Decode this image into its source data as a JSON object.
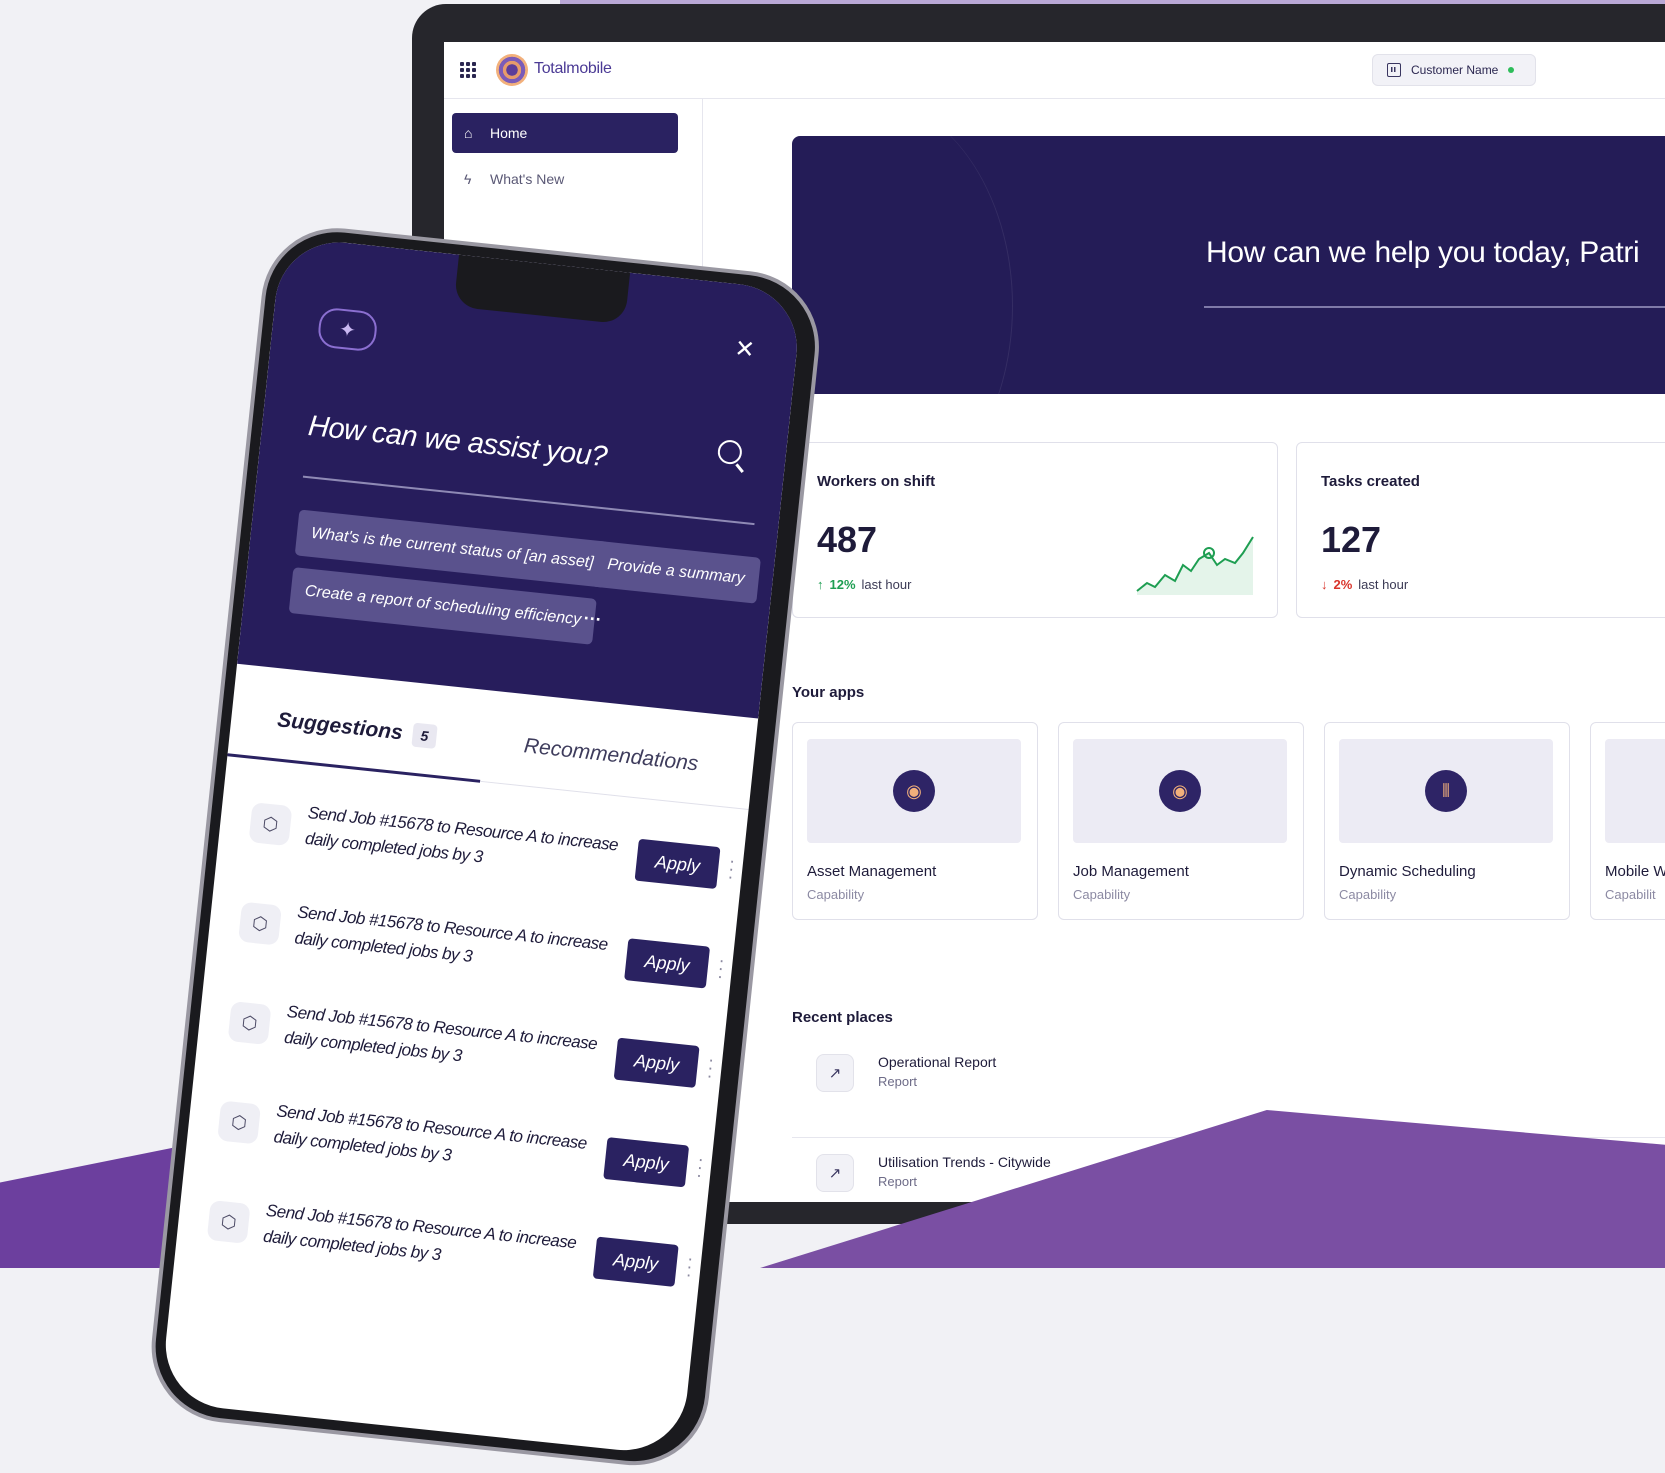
{
  "dashboard": {
    "brand": "Totalmobile",
    "customer_name": "Customer Name",
    "nav": [
      {
        "label": "Home"
      },
      {
        "label": "What's New"
      }
    ],
    "greeting": "How can we help you today, Patri",
    "stats": [
      {
        "title": "Workers on shift",
        "value": "487",
        "delta": "12%",
        "direction": "up",
        "period": "last hour"
      },
      {
        "title": "Tasks created",
        "value": "127",
        "delta": "2%",
        "direction": "down",
        "period": "last hour"
      }
    ],
    "apps_title": "Your apps",
    "apps": [
      {
        "name": "Asset Management",
        "sub": "Capability"
      },
      {
        "name": "Job Management",
        "sub": "Capability"
      },
      {
        "name": "Dynamic Scheduling",
        "sub": "Capability"
      },
      {
        "name": "Mobile W",
        "sub": "Capabilit"
      }
    ],
    "recent_title": "Recent places",
    "recent": [
      {
        "name": "Operational Report",
        "sub": "Report"
      },
      {
        "name": "Utilisation Trends - Citywide",
        "sub": "Report"
      }
    ]
  },
  "assistant": {
    "title": "How can we assist you?",
    "chips": [
      "What's is the current status of [an asset]",
      "Provide a summary",
      "Create a report of scheduling efficiency"
    ],
    "more": "···",
    "tabs": [
      {
        "label": "Suggestions",
        "count": "5"
      },
      {
        "label": "Recommendations"
      }
    ],
    "suggestions": [
      {
        "text": "Send Job #15678 to Resource A to increase daily completed jobs by 3",
        "action": "Apply"
      },
      {
        "text": "Send Job #15678 to Resource A to increase daily completed jobs by 3",
        "action": "Apply"
      },
      {
        "text": "Send Job #15678 to Resource A to increase daily completed jobs by 3",
        "action": "Apply"
      },
      {
        "text": "Send Job #15678 to Resource A to increase daily completed jobs by 3",
        "action": "Apply"
      },
      {
        "text": "Send Job #15678 to Resource A to increase daily completed jobs by 3",
        "action": "Apply"
      }
    ]
  },
  "colors": {
    "brand_navy": "#2a2261",
    "hero_bg": "#241c57",
    "accent_purple": "#7a4fa3",
    "up_green": "#1e9e52",
    "down_red": "#d9342b",
    "status_green": "#2ebd5a"
  },
  "icons": [
    "apps-grid-icon",
    "totalmobile-logo-icon",
    "building-icon",
    "home-icon",
    "bolt-icon",
    "sparkle-icon",
    "close-icon",
    "search-icon",
    "cube-icon",
    "kebab-icon",
    "report-icon"
  ]
}
